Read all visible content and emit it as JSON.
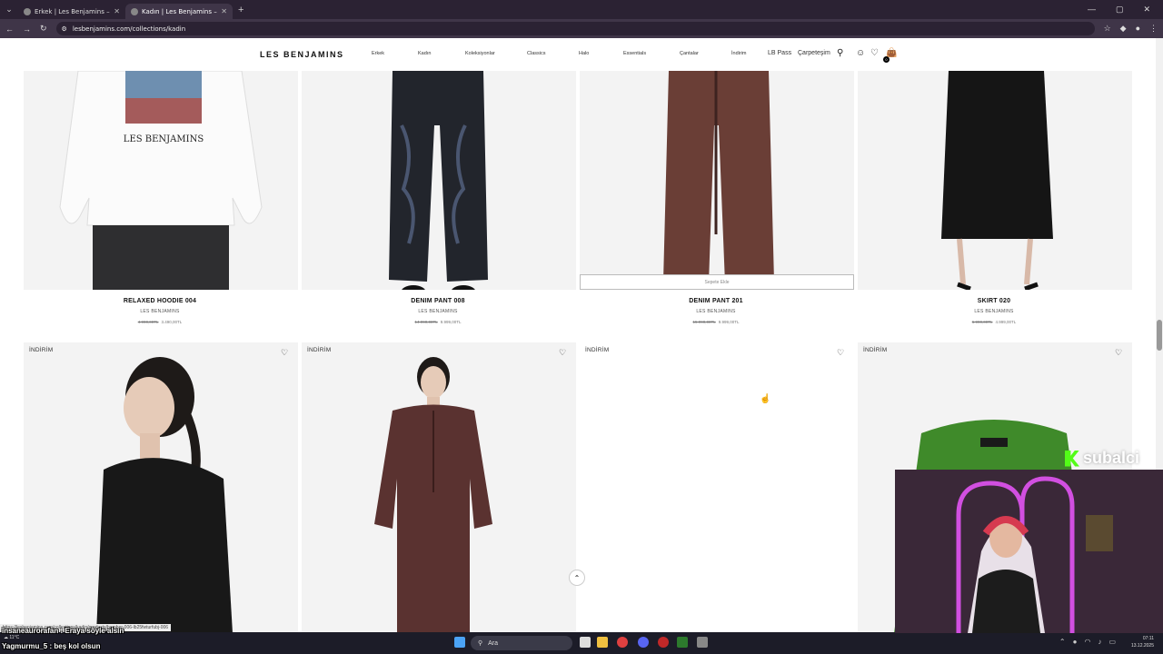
{
  "browser": {
    "tabs": [
      {
        "title": "Erkek | Les Benjamins – LES BE",
        "active": false
      },
      {
        "title": "Kadın | Les Benjamins – LES BE",
        "active": true
      }
    ],
    "url": "lesbenjamins.com/collections/kadin"
  },
  "header": {
    "logo": "LES BENJAMINS",
    "nav": [
      "Erkek",
      "Kadın",
      "Koleksiyonlar",
      "Classics",
      "Halo",
      "Essentials",
      "Çantalar",
      "İndirim"
    ],
    "lb_pass": "LB Pass",
    "wishlist_label": "Çarpeteşim",
    "cart_count": "0"
  },
  "products_row1": [
    {
      "name": "RELAXED HOODIE 004",
      "brand": "LES BENJAMINS",
      "old_price": "4.990,00TL",
      "price": "3.490,00TL"
    },
    {
      "name": "DENIM PANT 008",
      "brand": "LES BENJAMINS",
      "old_price": "14.990,00TL",
      "price": "9.999,00TL"
    },
    {
      "name": "DENIM PANT 201",
      "brand": "LES BENJAMINS",
      "old_price": "15.990,00TL",
      "price": "9.999,00TL"
    },
    {
      "name": "SKIRT 020",
      "brand": "LES BENJAMINS",
      "old_price": "6.990,00TL",
      "price": "4.999,00TL"
    }
  ],
  "add_to_cart": "Sepete Ekle",
  "products_row2_badge": "İNDİRİM",
  "status_link": "https://lesbenjamins.com/collections/kadin/products/bomber-006-lb25fwturfubj-006",
  "chat": [
    {
      "user": "insaneaurorafan",
      "msg": "Eraya söyle alsın"
    },
    {
      "user": "Yagmurmu_5",
      "msg": "beş kol olsun"
    }
  ],
  "overlay_brand": "subalci",
  "taskbar": {
    "search": "Ara",
    "weather": "11°C",
    "time": "07:11",
    "date": "13.12.2025"
  }
}
